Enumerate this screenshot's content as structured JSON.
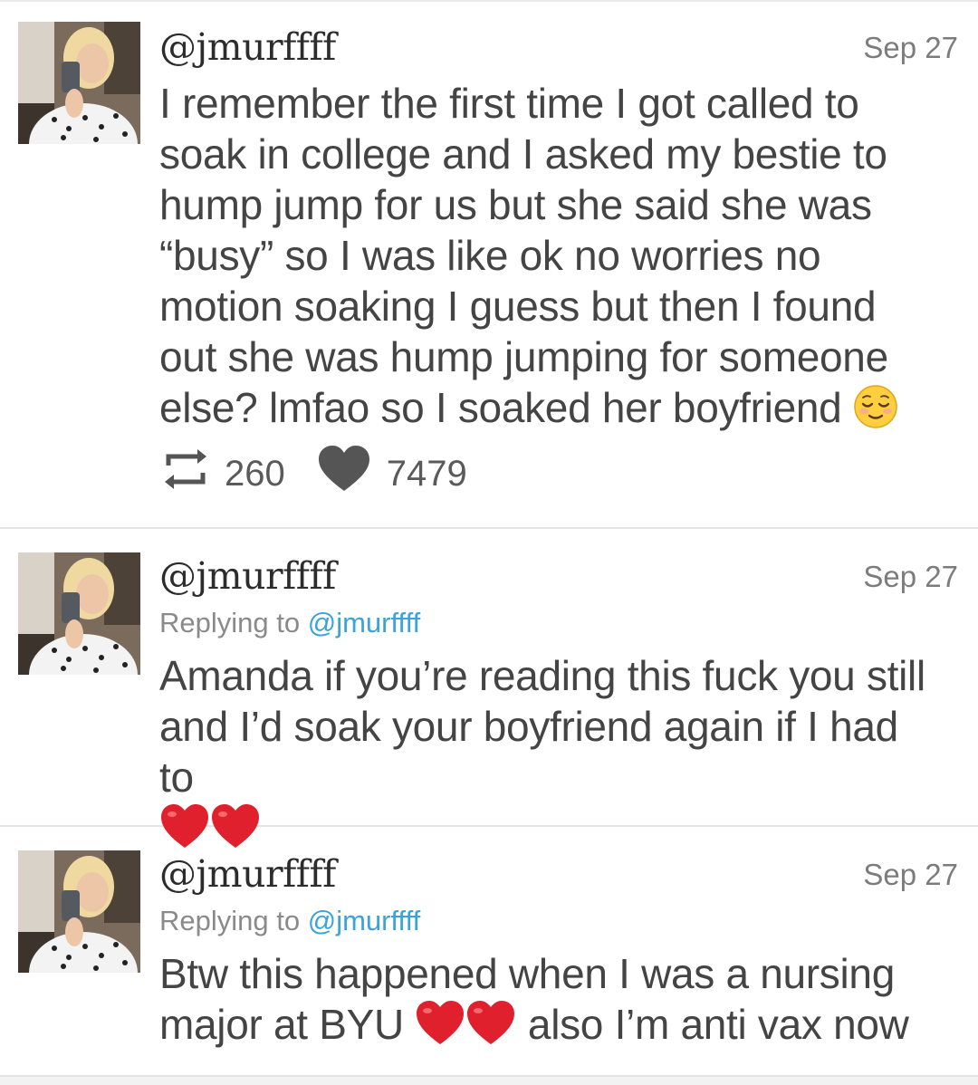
{
  "tweets": [
    {
      "handle": "@jmurffff",
      "date": "Sep 27",
      "text_before_emoji": "I remember the first time I got called to soak in college and I asked my bestie to hump jump for us but she said she was “busy” so I was like ok no worries no motion soaking I guess but then I found out she was hump jumping for someone else? lmfao so I soaked her boyfriend",
      "emoji": "relieved-face",
      "retweets": "260",
      "likes": "7479"
    },
    {
      "handle": "@jmurffff",
      "date": "Sep 27",
      "reply_prefix": "Replying to",
      "reply_to": "@jmurffff",
      "text": "Amanda if you’re reading this fuck you still and I’d soak your boyfriend again if I had to",
      "emoji": "two-red-hearts"
    },
    {
      "handle": "@jmurffff",
      "date": "Sep 27",
      "reply_prefix": "Replying to",
      "reply_to": "@jmurffff",
      "text_before_emoji": "Btw this happened when I was a nursing major at BYU",
      "emoji": "two-red-hearts",
      "text_after_emoji": "also I’m anti vax now"
    }
  ],
  "colors": {
    "handle": "#2c2c2c",
    "body_text": "#444444",
    "date": "#7c7c7c",
    "mention": "#3ba3d6",
    "divider": "#e4e4e4",
    "heart_emoji": "#e0202c",
    "like_icon": "#555555"
  }
}
